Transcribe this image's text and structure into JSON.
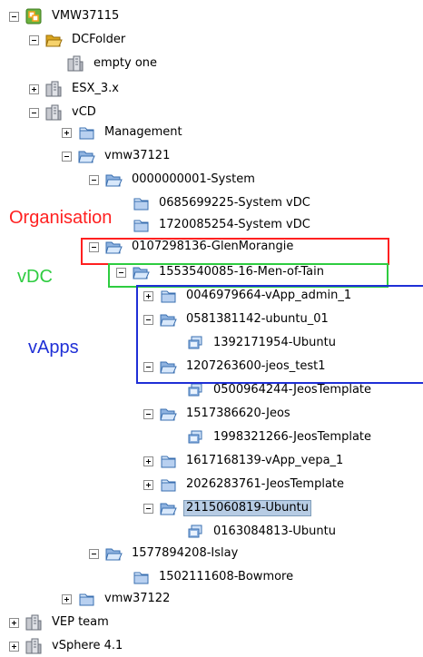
{
  "tree": [
    {
      "label": "VMW37115",
      "toggle": "minus",
      "icon": "vcenter-icon"
    },
    {
      "label": "DCFolder",
      "toggle": "minus",
      "icon": "open-folder-yellow-icon"
    },
    {
      "label": "empty one",
      "toggle": "none",
      "icon": "host-cluster-icon"
    },
    {
      "label": "ESX_3.x",
      "toggle": "plus",
      "icon": "host-cluster-icon"
    },
    {
      "label": "vCD",
      "toggle": "minus",
      "icon": "host-cluster-icon"
    },
    {
      "label": "Management",
      "toggle": "plus",
      "icon": "closed-folder-blue-icon"
    },
    {
      "label": "vmw37121",
      "toggle": "minus",
      "icon": "open-folder-blue-icon"
    },
    {
      "label": "0000000001-System",
      "toggle": "minus",
      "icon": "open-folder-blue-icon"
    },
    {
      "label": "0685699225-System vDC",
      "toggle": "none",
      "icon": "closed-folder-blue-icon"
    },
    {
      "label": "1720085254-System vDC",
      "toggle": "none",
      "icon": "closed-folder-blue-icon"
    },
    {
      "label": "0107298136-GlenMorangie",
      "toggle": "minus",
      "icon": "open-folder-blue-icon"
    },
    {
      "label": "1553540085-16-Men-of-Tain",
      "toggle": "minus",
      "icon": "open-folder-blue-icon"
    },
    {
      "label": "0046979664-vApp_admin_1",
      "toggle": "plus",
      "icon": "closed-folder-blue-icon"
    },
    {
      "label": "0581381142-ubuntu_01",
      "toggle": "minus",
      "icon": "open-folder-blue-icon"
    },
    {
      "label": "1392171954-Ubuntu",
      "toggle": "none",
      "icon": "vm-icon"
    },
    {
      "label": "1207263600-jeos_test1",
      "toggle": "minus",
      "icon": "open-folder-blue-icon"
    },
    {
      "label": "0500964244-JeosTemplate",
      "toggle": "none",
      "icon": "vm-icon"
    },
    {
      "label": "1517386620-Jeos",
      "toggle": "minus",
      "icon": "open-folder-blue-icon"
    },
    {
      "label": "1998321266-JeosTemplate",
      "toggle": "none",
      "icon": "vm-icon"
    },
    {
      "label": "1617168139-vApp_vepa_1",
      "toggle": "plus",
      "icon": "closed-folder-blue-icon"
    },
    {
      "label": "2026283761-JeosTemplate",
      "toggle": "plus",
      "icon": "closed-folder-blue-icon"
    },
    {
      "label": "2115060819-Ubuntu",
      "toggle": "minus",
      "icon": "open-folder-blue-icon",
      "selected": true
    },
    {
      "label": "0163084813-Ubuntu",
      "toggle": "none",
      "icon": "vm-icon"
    },
    {
      "label": "1577894208-Islay",
      "toggle": "minus",
      "icon": "open-folder-blue-icon"
    },
    {
      "label": "1502111608-Bowmore",
      "toggle": "none",
      "icon": "closed-folder-blue-icon"
    },
    {
      "label": "vmw37122",
      "toggle": "plus",
      "icon": "closed-folder-blue-icon"
    },
    {
      "label": "VEP team",
      "toggle": "plus",
      "icon": "host-cluster-icon"
    },
    {
      "label": "vSphere 4.1",
      "toggle": "plus",
      "icon": "host-cluster-icon"
    }
  ],
  "annotations": {
    "organisation": {
      "label": "Organisation",
      "color": "#ff2020"
    },
    "vdc": {
      "label": "vDC",
      "color": "#2ecc40"
    },
    "vapps": {
      "label": "vApps",
      "color": "#1f2fd6"
    }
  }
}
